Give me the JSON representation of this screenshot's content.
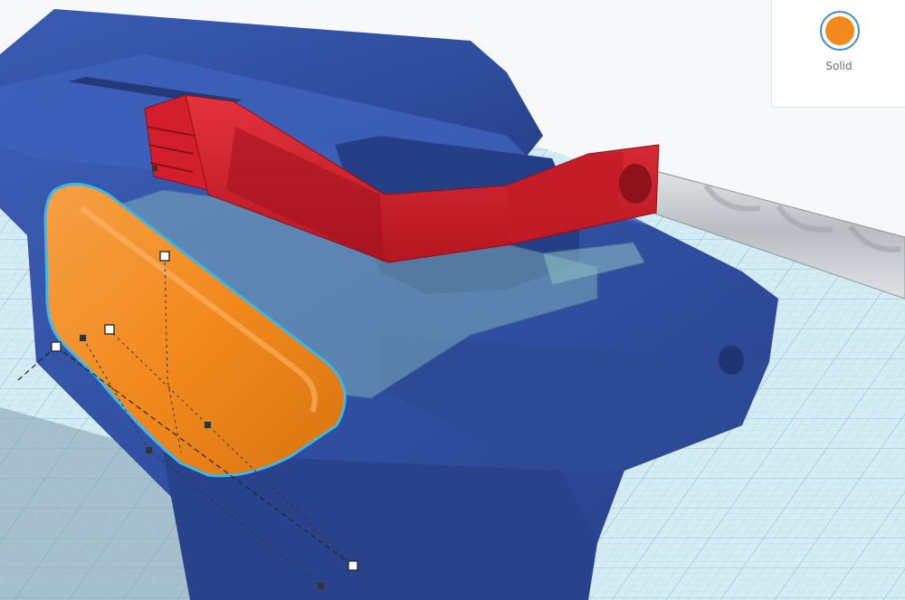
{
  "inspector": {
    "shape_type_label": "Solid",
    "shape_color": "#f28a1e",
    "selection_color": "#3bb8e6"
  },
  "scene": {
    "workplane_color": "#d4ecf3",
    "body_color": "#2f4d9e",
    "part_colors": {
      "trigger_bar": "#d31f2b",
      "side_panel": "#f28a1e",
      "hole_ghost": "#8fc3c4"
    }
  }
}
